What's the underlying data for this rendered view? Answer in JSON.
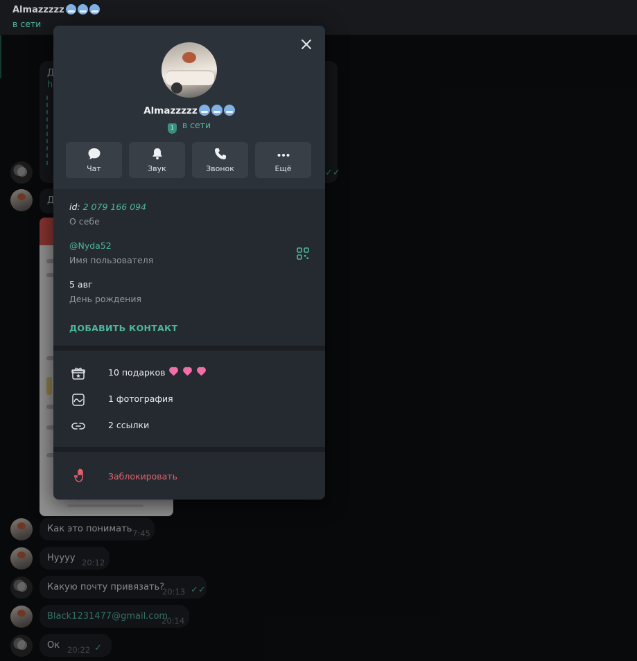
{
  "header": {
    "name": "Almazzzzz",
    "status": "в сети"
  },
  "chat": {
    "messages": [
      {
        "text": "Как это понимать",
        "time": "7:45"
      },
      {
        "text": "Нуууу",
        "time": "20:12"
      },
      {
        "text": "Какую почту привязать?",
        "time": "20:13",
        "read": true
      },
      {
        "text": "Black1231477@gmail.com",
        "time": "20:14"
      },
      {
        "text": "Ок",
        "time": "20:22",
        "read": true
      }
    ],
    "partial_letters": [
      "Д",
      "h",
      "Д"
    ]
  },
  "profile": {
    "name": "Almazzzzz",
    "status": "в сети",
    "shield_badge": "1",
    "actions": [
      {
        "label": "Чат",
        "icon": "chat-bubble-icon"
      },
      {
        "label": "Звук",
        "icon": "bell-icon"
      },
      {
        "label": "Звонок",
        "icon": "phone-icon"
      },
      {
        "label": "Ещё",
        "icon": "more-dots-icon"
      }
    ],
    "id_label": "id:",
    "id_value": "2 079 166 094",
    "id_caption": "О себе",
    "username": "@Nyda52",
    "username_caption": "Имя пользователя",
    "birthday": "5 авг",
    "birthday_caption": "День рождения",
    "add_contact": "ДОБАВИТЬ КОНТАКТ",
    "media": [
      {
        "label": "10 подарков",
        "icon": "gift-icon"
      },
      {
        "label": "1 фотография",
        "icon": "photo-icon"
      },
      {
        "label": "2 ссылки",
        "icon": "link-icon"
      }
    ],
    "block": {
      "label": "Заблокировать",
      "icon": "hand-stop-icon"
    }
  },
  "colors": {
    "accent": "#4fb6a0",
    "danger": "#e0616a",
    "panel_bg": "#252a30",
    "panel_top": "#2c3239",
    "button_bg": "#383f47"
  }
}
